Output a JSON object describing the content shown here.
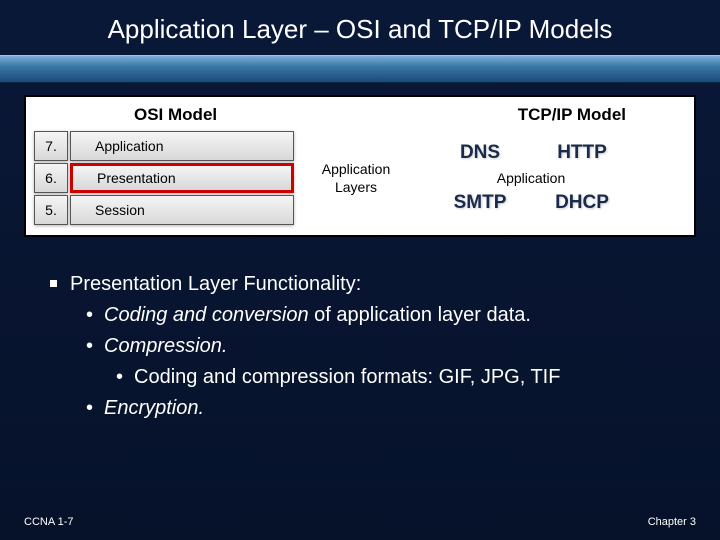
{
  "slide": {
    "title": "Application Layer – OSI and TCP/IP Models"
  },
  "diagram": {
    "osi_header": "OSI Model",
    "tcpip_header": "TCP/IP Model",
    "rows": [
      {
        "num": "7.",
        "name": "Application"
      },
      {
        "num": "6.",
        "name": "Presentation"
      },
      {
        "num": "5.",
        "name": "Session"
      }
    ],
    "mid_label_1": "Application",
    "mid_label_2": "Layers",
    "services": {
      "dns": "DNS",
      "http": "HTTP",
      "app": "Application",
      "smtp": "SMTP",
      "dhcp": "DHCP"
    }
  },
  "content": {
    "heading": "Presentation Layer Functionality:",
    "b1a_em": "Coding and conversion",
    "b1a_rest": " of application layer data.",
    "b1b": "Compression.",
    "b2a": "Coding and compression formats: GIF, JPG, TIF",
    "b1c": "Encryption."
  },
  "footer": {
    "left": "CCNA 1-7",
    "right": "Chapter 3"
  }
}
